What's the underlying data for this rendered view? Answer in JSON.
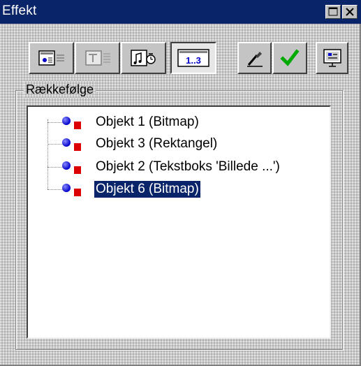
{
  "window": {
    "title": "Effekt"
  },
  "toolbar": {
    "buttons": [
      {
        "name": "effect-tab",
        "icon": "appearance-icon",
        "pressed": false
      },
      {
        "name": "text-tab",
        "icon": "text-animation-icon",
        "pressed": false
      },
      {
        "name": "sound-timing-tab",
        "icon": "sound-timing-icon",
        "pressed": false
      },
      {
        "name": "order-tab",
        "icon": "order-icon",
        "label": "1..3",
        "pressed": true
      },
      {
        "name": "eyedropper",
        "icon": "eyedropper-icon",
        "pressed": false
      },
      {
        "name": "apply",
        "icon": "checkmark-icon",
        "pressed": false
      },
      {
        "name": "preview",
        "icon": "preview-icon",
        "pressed": false
      }
    ]
  },
  "order_group": {
    "label": "Rækkefølge",
    "items": [
      {
        "label": "Objekt 1 (Bitmap)",
        "selected": false
      },
      {
        "label": "Objekt 3 (Rektangel)",
        "selected": false
      },
      {
        "label": "Objekt 2 (Tekstboks 'Billede ...')",
        "selected": false
      },
      {
        "label": "Objekt 6 (Bitmap)",
        "selected": true
      }
    ]
  },
  "colors": {
    "titlebar": "#0a246a",
    "selection": "#0a246a",
    "dot": "#0000cc",
    "square": "#dd0000",
    "check": "#00aa00"
  }
}
